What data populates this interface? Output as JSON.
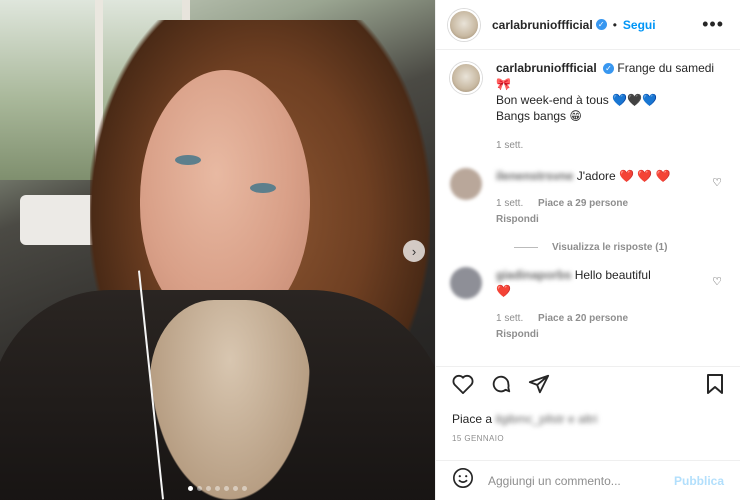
{
  "header": {
    "username": "carlabrunioffficial",
    "separator": "•",
    "follow_label": "Segui",
    "more_icon": "more-dots-icon"
  },
  "caption": {
    "username": "carlabrunioffficial",
    "line1": "Frange du samedi",
    "line1_emoji": "🎀",
    "line2": "Bon week-end à tous",
    "line2_emoji": "💙🖤💙",
    "line3": "Bangs bangs",
    "line3_emoji": "😁",
    "time": "1 sett."
  },
  "comments": [
    {
      "username": "blurred",
      "text": "J'adore",
      "emoji": "❤️ ❤️ ❤️",
      "time": "1 sett.",
      "likes": "Piace a 29 persone",
      "reply": "Rispondi"
    },
    {
      "username": "blurred",
      "text": "Hello beautiful",
      "emoji": "❤️",
      "time": "1 sett.",
      "likes": "Piace a 20 persone",
      "reply": "Rispondi"
    }
  ],
  "view_replies": "Visualizza le risposte (1)",
  "actions": {
    "like_icon": "heart-icon",
    "comment_icon": "comment-icon",
    "share_icon": "send-icon",
    "save_icon": "bookmark-icon"
  },
  "likes_text": "Piace a",
  "date": "15 GENNAIO",
  "add_comment": {
    "placeholder": "Aggiungi un commento...",
    "publish_label": "Pubblica",
    "emoji_icon": "smiley-icon"
  },
  "carousel": {
    "slides": 7,
    "active": 1
  },
  "colors": {
    "accent": "#0095f6",
    "publish_disabled": "#b2dffc",
    "heart": "#ed4956"
  }
}
